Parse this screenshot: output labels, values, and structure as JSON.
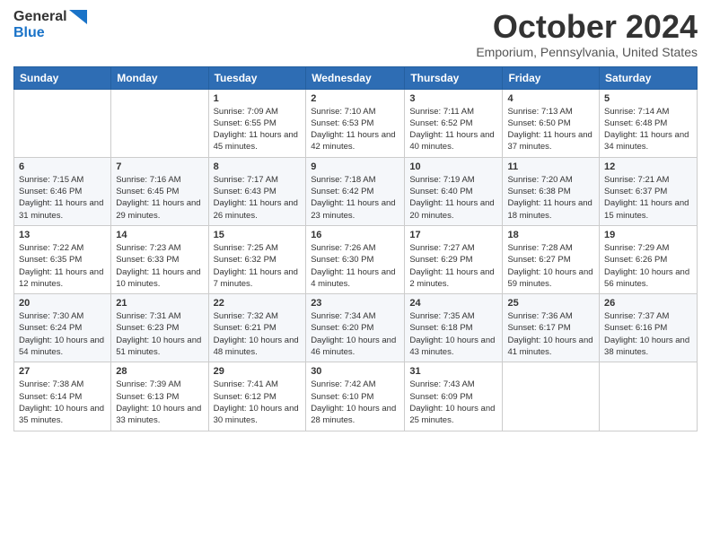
{
  "logo": {
    "general": "General",
    "blue": "Blue"
  },
  "header": {
    "month": "October 2024",
    "location": "Emporium, Pennsylvania, United States"
  },
  "weekdays": [
    "Sunday",
    "Monday",
    "Tuesday",
    "Wednesday",
    "Thursday",
    "Friday",
    "Saturday"
  ],
  "weeks": [
    [
      {
        "day": "",
        "sunrise": "",
        "sunset": "",
        "daylight": ""
      },
      {
        "day": "",
        "sunrise": "",
        "sunset": "",
        "daylight": ""
      },
      {
        "day": "1",
        "sunrise": "Sunrise: 7:09 AM",
        "sunset": "Sunset: 6:55 PM",
        "daylight": "Daylight: 11 hours and 45 minutes."
      },
      {
        "day": "2",
        "sunrise": "Sunrise: 7:10 AM",
        "sunset": "Sunset: 6:53 PM",
        "daylight": "Daylight: 11 hours and 42 minutes."
      },
      {
        "day": "3",
        "sunrise": "Sunrise: 7:11 AM",
        "sunset": "Sunset: 6:52 PM",
        "daylight": "Daylight: 11 hours and 40 minutes."
      },
      {
        "day": "4",
        "sunrise": "Sunrise: 7:13 AM",
        "sunset": "Sunset: 6:50 PM",
        "daylight": "Daylight: 11 hours and 37 minutes."
      },
      {
        "day": "5",
        "sunrise": "Sunrise: 7:14 AM",
        "sunset": "Sunset: 6:48 PM",
        "daylight": "Daylight: 11 hours and 34 minutes."
      }
    ],
    [
      {
        "day": "6",
        "sunrise": "Sunrise: 7:15 AM",
        "sunset": "Sunset: 6:46 PM",
        "daylight": "Daylight: 11 hours and 31 minutes."
      },
      {
        "day": "7",
        "sunrise": "Sunrise: 7:16 AM",
        "sunset": "Sunset: 6:45 PM",
        "daylight": "Daylight: 11 hours and 29 minutes."
      },
      {
        "day": "8",
        "sunrise": "Sunrise: 7:17 AM",
        "sunset": "Sunset: 6:43 PM",
        "daylight": "Daylight: 11 hours and 26 minutes."
      },
      {
        "day": "9",
        "sunrise": "Sunrise: 7:18 AM",
        "sunset": "Sunset: 6:42 PM",
        "daylight": "Daylight: 11 hours and 23 minutes."
      },
      {
        "day": "10",
        "sunrise": "Sunrise: 7:19 AM",
        "sunset": "Sunset: 6:40 PM",
        "daylight": "Daylight: 11 hours and 20 minutes."
      },
      {
        "day": "11",
        "sunrise": "Sunrise: 7:20 AM",
        "sunset": "Sunset: 6:38 PM",
        "daylight": "Daylight: 11 hours and 18 minutes."
      },
      {
        "day": "12",
        "sunrise": "Sunrise: 7:21 AM",
        "sunset": "Sunset: 6:37 PM",
        "daylight": "Daylight: 11 hours and 15 minutes."
      }
    ],
    [
      {
        "day": "13",
        "sunrise": "Sunrise: 7:22 AM",
        "sunset": "Sunset: 6:35 PM",
        "daylight": "Daylight: 11 hours and 12 minutes."
      },
      {
        "day": "14",
        "sunrise": "Sunrise: 7:23 AM",
        "sunset": "Sunset: 6:33 PM",
        "daylight": "Daylight: 11 hours and 10 minutes."
      },
      {
        "day": "15",
        "sunrise": "Sunrise: 7:25 AM",
        "sunset": "Sunset: 6:32 PM",
        "daylight": "Daylight: 11 hours and 7 minutes."
      },
      {
        "day": "16",
        "sunrise": "Sunrise: 7:26 AM",
        "sunset": "Sunset: 6:30 PM",
        "daylight": "Daylight: 11 hours and 4 minutes."
      },
      {
        "day": "17",
        "sunrise": "Sunrise: 7:27 AM",
        "sunset": "Sunset: 6:29 PM",
        "daylight": "Daylight: 11 hours and 2 minutes."
      },
      {
        "day": "18",
        "sunrise": "Sunrise: 7:28 AM",
        "sunset": "Sunset: 6:27 PM",
        "daylight": "Daylight: 10 hours and 59 minutes."
      },
      {
        "day": "19",
        "sunrise": "Sunrise: 7:29 AM",
        "sunset": "Sunset: 6:26 PM",
        "daylight": "Daylight: 10 hours and 56 minutes."
      }
    ],
    [
      {
        "day": "20",
        "sunrise": "Sunrise: 7:30 AM",
        "sunset": "Sunset: 6:24 PM",
        "daylight": "Daylight: 10 hours and 54 minutes."
      },
      {
        "day": "21",
        "sunrise": "Sunrise: 7:31 AM",
        "sunset": "Sunset: 6:23 PM",
        "daylight": "Daylight: 10 hours and 51 minutes."
      },
      {
        "day": "22",
        "sunrise": "Sunrise: 7:32 AM",
        "sunset": "Sunset: 6:21 PM",
        "daylight": "Daylight: 10 hours and 48 minutes."
      },
      {
        "day": "23",
        "sunrise": "Sunrise: 7:34 AM",
        "sunset": "Sunset: 6:20 PM",
        "daylight": "Daylight: 10 hours and 46 minutes."
      },
      {
        "day": "24",
        "sunrise": "Sunrise: 7:35 AM",
        "sunset": "Sunset: 6:18 PM",
        "daylight": "Daylight: 10 hours and 43 minutes."
      },
      {
        "day": "25",
        "sunrise": "Sunrise: 7:36 AM",
        "sunset": "Sunset: 6:17 PM",
        "daylight": "Daylight: 10 hours and 41 minutes."
      },
      {
        "day": "26",
        "sunrise": "Sunrise: 7:37 AM",
        "sunset": "Sunset: 6:16 PM",
        "daylight": "Daylight: 10 hours and 38 minutes."
      }
    ],
    [
      {
        "day": "27",
        "sunrise": "Sunrise: 7:38 AM",
        "sunset": "Sunset: 6:14 PM",
        "daylight": "Daylight: 10 hours and 35 minutes."
      },
      {
        "day": "28",
        "sunrise": "Sunrise: 7:39 AM",
        "sunset": "Sunset: 6:13 PM",
        "daylight": "Daylight: 10 hours and 33 minutes."
      },
      {
        "day": "29",
        "sunrise": "Sunrise: 7:41 AM",
        "sunset": "Sunset: 6:12 PM",
        "daylight": "Daylight: 10 hours and 30 minutes."
      },
      {
        "day": "30",
        "sunrise": "Sunrise: 7:42 AM",
        "sunset": "Sunset: 6:10 PM",
        "daylight": "Daylight: 10 hours and 28 minutes."
      },
      {
        "day": "31",
        "sunrise": "Sunrise: 7:43 AM",
        "sunset": "Sunset: 6:09 PM",
        "daylight": "Daylight: 10 hours and 25 minutes."
      },
      {
        "day": "",
        "sunrise": "",
        "sunset": "",
        "daylight": ""
      },
      {
        "day": "",
        "sunrise": "",
        "sunset": "",
        "daylight": ""
      }
    ]
  ]
}
